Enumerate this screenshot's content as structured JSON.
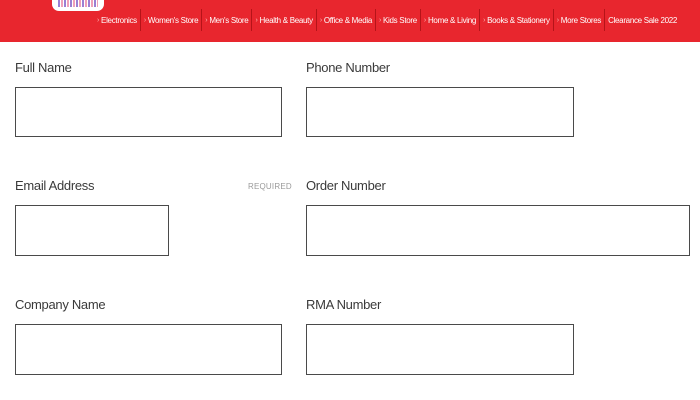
{
  "nav": {
    "items": [
      {
        "label": "Electronics"
      },
      {
        "label": "Women's Store"
      },
      {
        "label": "Men's Store"
      },
      {
        "label": "Health & Beauty"
      },
      {
        "label": "Office & Media"
      },
      {
        "label": "Kids Store"
      },
      {
        "label": "Home & Living"
      },
      {
        "label": "Books & Stationery"
      },
      {
        "label": "More Stores"
      },
      {
        "label": "Clearance Sale 2022"
      }
    ]
  },
  "form": {
    "full_name": {
      "label": "Full Name",
      "value": ""
    },
    "phone_number": {
      "label": "Phone Number",
      "value": ""
    },
    "email_address": {
      "label": "Email Address",
      "required": "REQUIRED",
      "value": ""
    },
    "order_number": {
      "label": "Order Number",
      "value": ""
    },
    "company_name": {
      "label": "Company Name",
      "value": ""
    },
    "rma_number": {
      "label": "RMA Number",
      "value": ""
    }
  },
  "colors": {
    "nav_background": "#e8262e",
    "field_border": "#4a4a4a",
    "label_text": "#3a3a3a"
  }
}
